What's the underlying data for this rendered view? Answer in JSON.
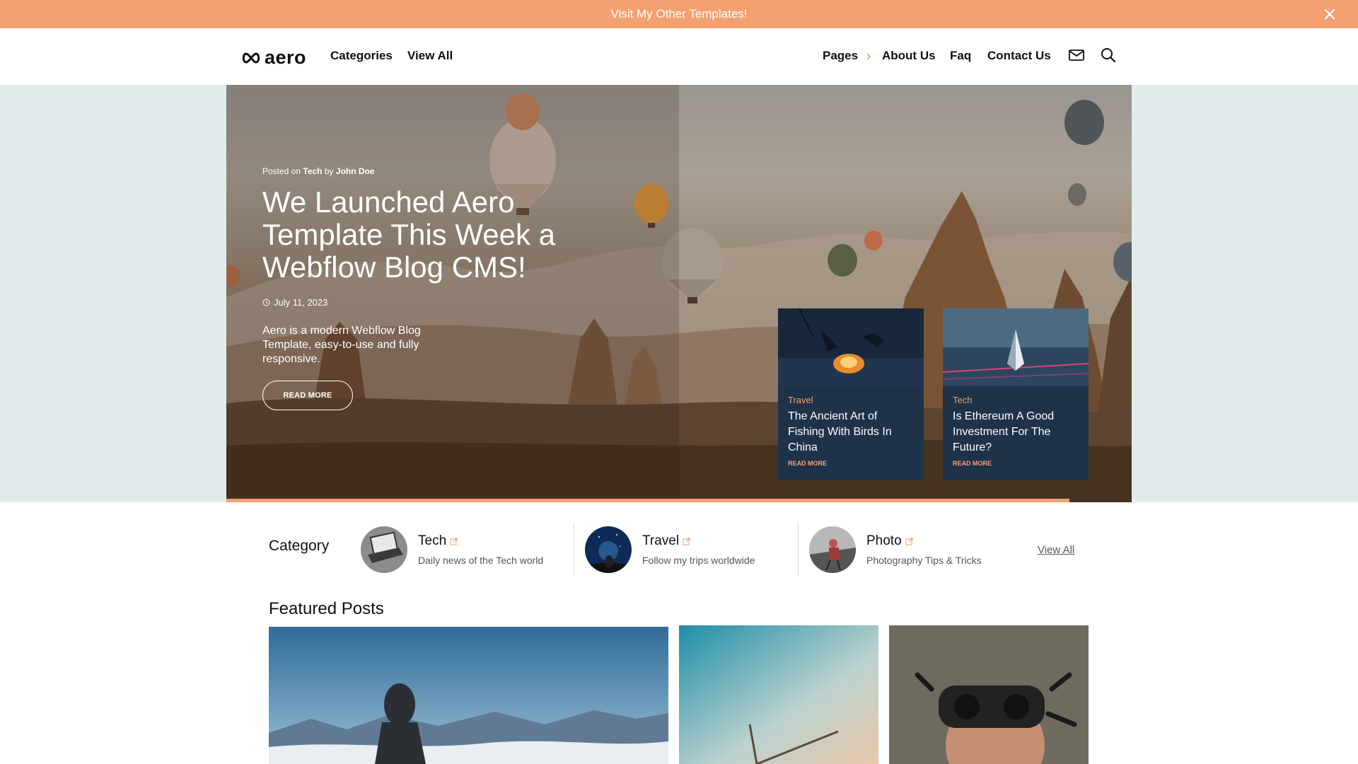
{
  "promo": {
    "text": "Visit My Other Templates!",
    "close_icon": "close-icon"
  },
  "nav": {
    "logo": "aero",
    "left_links": [
      "Categories",
      "View All"
    ],
    "right_links": [
      "Pages",
      "About Us",
      "Faq",
      "Contact Us"
    ],
    "icons": [
      "mail-icon",
      "search-icon"
    ],
    "accent": "#f4a070"
  },
  "hero": {
    "posted_prefix": "Posted on",
    "category": "Tech",
    "by": "by",
    "author": "John Doe",
    "title": "We Launched Aero Template This Week a Webflow Blog CMS!",
    "date": "July 11, 2023",
    "description": "Aero is a modern Webflow Blog Template, easy-to-use and fully responsive.",
    "button": "READ MORE",
    "cards": [
      {
        "category": "Travel",
        "title": "The Ancient Art of Fishing With Birds In China",
        "more": "READ MORE"
      },
      {
        "category": "Tech",
        "title": "Is Ethereum A Good Investment For The Future?",
        "more": "READ MORE"
      }
    ]
  },
  "categories": {
    "label": "Category",
    "items": [
      {
        "name": "Tech",
        "description": "Daily news of the Tech world"
      },
      {
        "name": "Travel",
        "description": "Follow my trips worldwide"
      },
      {
        "name": "Photo",
        "description": "Photography Tips & Tricks"
      }
    ],
    "view_all": "View All"
  },
  "featured": {
    "heading": "Featured Posts"
  },
  "colors": {
    "accent": "#f4a070",
    "card_bg": "#1e3249",
    "hero_band": "#e1ebeb"
  }
}
